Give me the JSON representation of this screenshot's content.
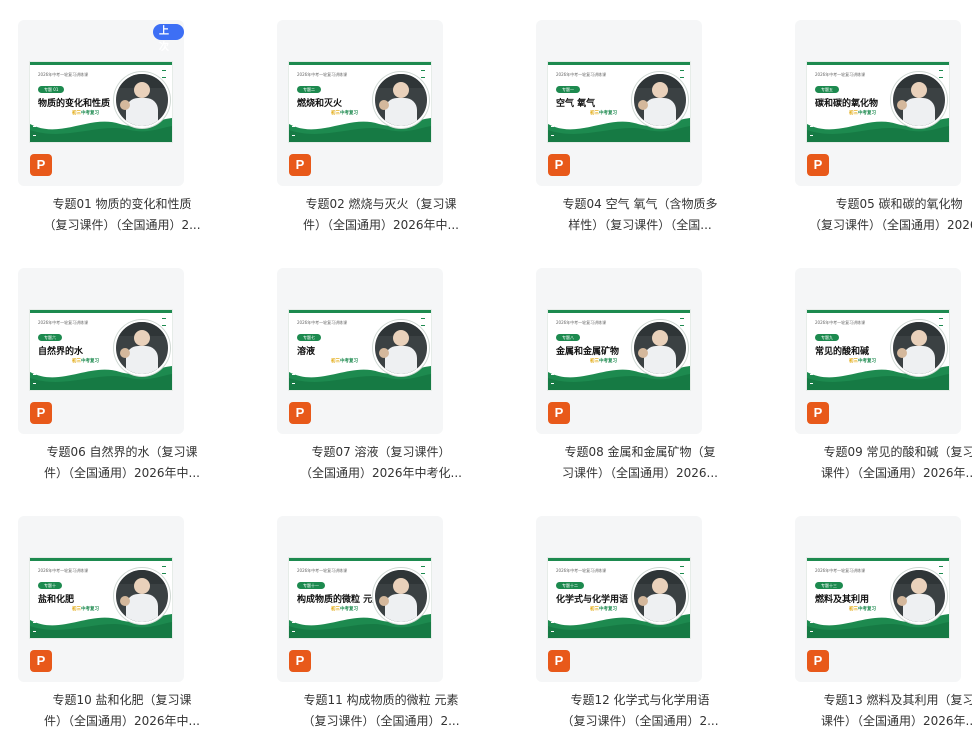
{
  "badge_last": "上次",
  "items": [
    {
      "slide_topline": "2026年中考一轮复习讲练课",
      "slide_chip": "专题 01",
      "slide_title": "物质的变化和性质",
      "slide_sub_accent": "初三",
      "slide_sub": "中考复习",
      "file_type": "P",
      "caption_line1": "专题01 物质的变化和性质",
      "caption_line2": "（复习课件）（全国通用）2..."
    },
    {
      "slide_topline": "2026年中考一轮复习讲练课",
      "slide_chip": "专题二",
      "slide_title": "燃烧和灭火",
      "slide_sub_accent": "初三",
      "slide_sub": "中考复习",
      "file_type": "P",
      "caption_line1": "专题02 燃烧与灭火（复习课",
      "caption_line2": "件）（全国通用）2026年中..."
    },
    {
      "slide_topline": "2026年中考一轮复习讲练课",
      "slide_chip": "专题一",
      "slide_title": "空气  氧气",
      "slide_sub_accent": "初三",
      "slide_sub": "中考复习",
      "file_type": "P",
      "caption_line1": "专题04 空气 氧气（含物质多",
      "caption_line2": "样性）（复习课件）（全国..."
    },
    {
      "slide_topline": "2026年中考一轮复习讲练课",
      "slide_chip": "专题五",
      "slide_title": "碳和碳的氧化物",
      "slide_sub_accent": "初三",
      "slide_sub": "中考复习",
      "file_type": "P",
      "caption_line1": "专题05 碳和碳的氧化物",
      "caption_line2": "（复习课件）（全国通用）2026..."
    },
    {
      "slide_topline": "2026年中考一轮复习讲练课",
      "slide_chip": "专题六",
      "slide_title": "自然界的水",
      "slide_sub_accent": "初三",
      "slide_sub": "中考复习",
      "file_type": "P",
      "caption_line1": "专题06 自然界的水（复习课",
      "caption_line2": "件）（全国通用）2026年中..."
    },
    {
      "slide_topline": "2026年中考一轮复习讲练课",
      "slide_chip": "专题七",
      "slide_title": "溶液",
      "slide_sub_accent": "初三",
      "slide_sub": "中考复习",
      "file_type": "P",
      "caption_line1": "专题07 溶液（复习课件）",
      "caption_line2": "（全国通用）2026年中考化..."
    },
    {
      "slide_topline": "2026年中考一轮复习讲练课",
      "slide_chip": "专题八",
      "slide_title": "金属和金属矿物",
      "slide_sub_accent": "初三",
      "slide_sub": "中考复习",
      "file_type": "P",
      "caption_line1": "专题08 金属和金属矿物（复",
      "caption_line2": "习课件）（全国通用）2026..."
    },
    {
      "slide_topline": "2026年中考一轮复习讲练课",
      "slide_chip": "专题九",
      "slide_title": "常见的酸和碱",
      "slide_sub_accent": "初三",
      "slide_sub": "中考复习",
      "file_type": "P",
      "caption_line1": "专题09 常见的酸和碱（复习",
      "caption_line2": "课件）（全国通用）2026年..."
    },
    {
      "slide_topline": "2026年中考一轮复习讲练课",
      "slide_chip": "专题十",
      "slide_title": "盐和化肥",
      "slide_sub_accent": "初三",
      "slide_sub": "中考复习",
      "file_type": "P",
      "caption_line1": "专题10 盐和化肥（复习课",
      "caption_line2": "件）（全国通用）2026年中..."
    },
    {
      "slide_topline": "2026年中考一轮复习讲练课",
      "slide_chip": "专题十一",
      "slide_title": "构成物质的微粒 元素",
      "slide_sub_accent": "初三",
      "slide_sub": "中考复习",
      "file_type": "P",
      "caption_line1": "专题11 构成物质的微粒 元素",
      "caption_line2": "（复习课件）（全国通用）2..."
    },
    {
      "slide_topline": "2026年中考一轮复习讲练课",
      "slide_chip": "专题十二",
      "slide_title": "化学式与化学用语",
      "slide_sub_accent": "初三",
      "slide_sub": "中考复习",
      "file_type": "P",
      "caption_line1": "专题12 化学式与化学用语",
      "caption_line2": "（复习课件）（全国通用）2..."
    },
    {
      "slide_topline": "2026年中考一轮复习讲练课",
      "slide_chip": "专题十三",
      "slide_title": "燃料及其利用",
      "slide_sub_accent": "初三",
      "slide_sub": "中考复习",
      "file_type": "P",
      "caption_line1": "专题13 燃料及其利用（复习",
      "caption_line2": "课件）（全国通用）2026年..."
    }
  ]
}
